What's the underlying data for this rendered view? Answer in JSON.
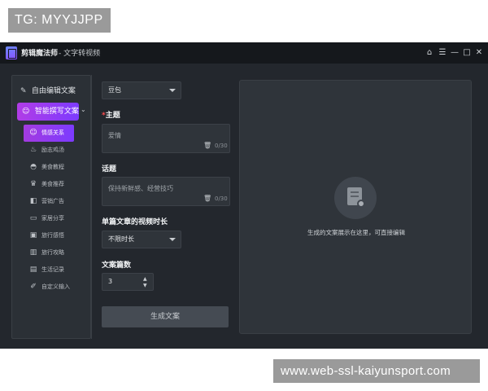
{
  "overlays": {
    "top_left": "TG: MYYJJPP",
    "bottom_right": "www.web-ssl-kaiyunsport.com"
  },
  "app": {
    "title": "剪辑魔法师",
    "subtitle": "- 文字转视频",
    "window_controls": [
      "home-icon",
      "menu-icon",
      "minimize-icon",
      "maximize-icon",
      "close-icon"
    ]
  },
  "sidebar": {
    "free_edit": "自由编辑文案",
    "smart_write": "智能撰写文案",
    "items": [
      {
        "label": "情感关系",
        "icon": "smile-icon",
        "active": true
      },
      {
        "label": "励志鸡汤",
        "icon": "bottle-icon",
        "active": false
      },
      {
        "label": "美食教程",
        "icon": "bowl-icon",
        "active": false
      },
      {
        "label": "美食推荐",
        "icon": "chef-icon",
        "active": false
      },
      {
        "label": "营销广告",
        "icon": "megaphone-icon",
        "active": false
      },
      {
        "label": "家居分享",
        "icon": "sofa-icon",
        "active": false
      },
      {
        "label": "旅行感悟",
        "icon": "suitcase-icon",
        "active": false
      },
      {
        "label": "旅行攻略",
        "icon": "map-icon",
        "active": false
      },
      {
        "label": "生活记录",
        "icon": "notebook-icon",
        "active": false
      },
      {
        "label": "自定义输入",
        "icon": "edit-icon",
        "active": false
      }
    ]
  },
  "form": {
    "model_select": "豆包",
    "topic_required_mark": "*",
    "topic_label": "主题",
    "topic_value": "爱情",
    "topic_count": "0/30",
    "talk_label": "话题",
    "talk_placeholder": "保持新鲜感、经营技巧",
    "talk_count": "0/30",
    "duration_label": "单篇文章的视频时长",
    "duration_select": "不限时长",
    "count_label": "文案篇数",
    "count_value": "3",
    "generate_button": "生成文案"
  },
  "preview": {
    "hint": "生成的文案展示在这里，可直接编辑"
  },
  "colors": {
    "accent_gradient_start": "#b13ce6",
    "accent_gradient_end": "#7c3bff",
    "background": "#23272d",
    "required": "#ff4d4f"
  }
}
